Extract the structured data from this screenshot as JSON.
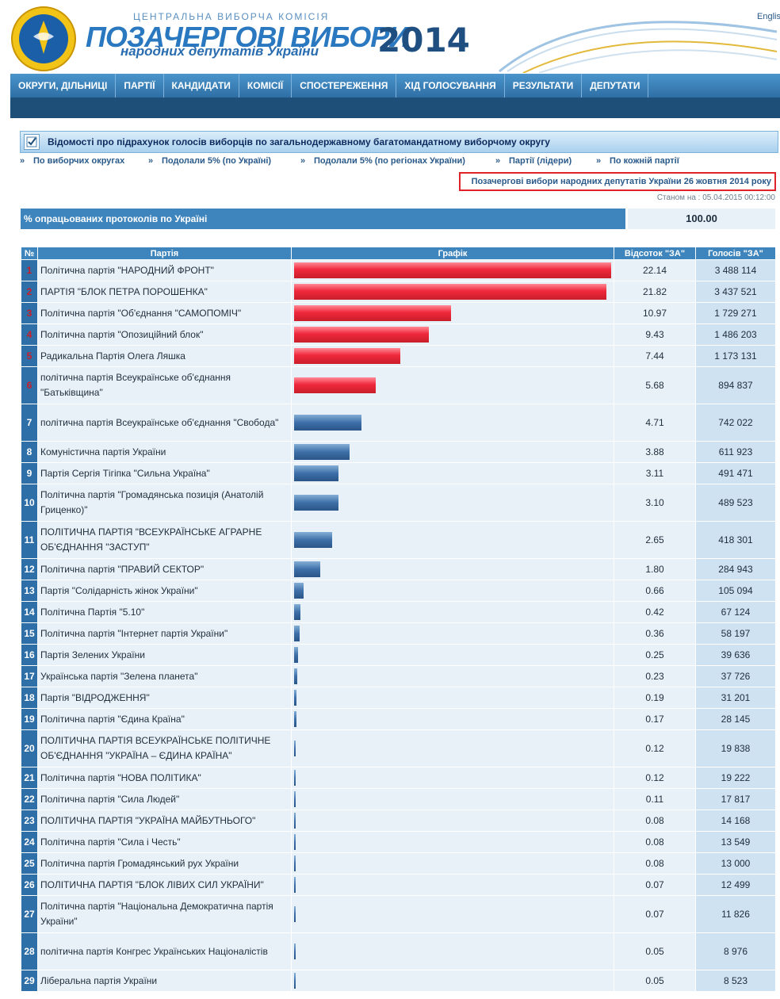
{
  "header": {
    "org": "ЦЕНТРАЛЬНА ВИБОРЧА КОМІСІЯ",
    "title": "ПОЗАЧЕРГОВІ ВИБОРИ",
    "subtitle": "народних депутатів України",
    "year": "2014",
    "lang": "English",
    "emblem_text": "ЦЕНТРАЛЬНА ВИБОРЧА КОМІСІЯ"
  },
  "nav": {
    "items": [
      "ОКРУГИ, ДІЛЬНИЦІ",
      "ПАРТІЇ",
      "КАНДИДАТИ",
      "КОМІСІЇ",
      "СПОСТЕРЕЖЕННЯ",
      "ХІД ГОЛОСУВАННЯ",
      "РЕЗУЛЬТАТИ",
      "ДЕПУТАТИ"
    ]
  },
  "section": {
    "title": "Відомості про підрахунок голосів виборців по загальнодержавному багатомандатному виборчому округу"
  },
  "subnav": {
    "items": [
      "По виборчих округах",
      "Подолали 5% (по Україні)",
      "Подолали 5% (по регіонах України)",
      "Партії (лідери)",
      "По кожній партії"
    ],
    "prefix": "»"
  },
  "election_link": "Позачергові вибори народних депутатів України 26 жовтня 2014 року",
  "status": "Станом на : 05.04.2015 00:12:00",
  "protocols": {
    "label": "% опрацьованих протоколів по Україні",
    "value": "100.00"
  },
  "table": {
    "headers": [
      "№",
      "Партія",
      "Графік",
      "Відсоток \"ЗА\"",
      "Голосів \"ЗА\""
    ],
    "rows": [
      {
        "n": "1",
        "party": "Політична партія \"НАРОДНИЙ ФРОНТ\"",
        "pct": "22.14",
        "votes": "3 488 114",
        "color": "red"
      },
      {
        "n": "2",
        "party": "ПАРТІЯ \"БЛОК ПЕТРА ПОРОШЕНКА\"",
        "pct": "21.82",
        "votes": "3 437 521",
        "color": "red"
      },
      {
        "n": "3",
        "party": "Політична партія \"Об'єднання \"САМОПОМІЧ\"",
        "pct": "10.97",
        "votes": "1 729 271",
        "color": "red"
      },
      {
        "n": "4",
        "party": "Політична партія \"Опозиційний блок\"",
        "pct": "9.43",
        "votes": "1 486 203",
        "color": "red"
      },
      {
        "n": "5",
        "party": "Радикальна Партія Олега Ляшка",
        "pct": "7.44",
        "votes": "1 173 131",
        "color": "red"
      },
      {
        "n": "6",
        "party": "політична партія Всеукраїнське об'єднання \"Батьківщина\"",
        "pct": "5.68",
        "votes": "894 837",
        "color": "red"
      },
      {
        "n": "7",
        "party": "політична партія Всеукраїнське об'єднання \"Свобода\"",
        "pct": "4.71",
        "votes": "742 022",
        "color": "blue"
      },
      {
        "n": "8",
        "party": "Комуністична партія України",
        "pct": "3.88",
        "votes": "611 923",
        "color": "blue"
      },
      {
        "n": "9",
        "party": "Партія Сергія Тігіпка \"Сильна Україна\"",
        "pct": "3.11",
        "votes": "491 471",
        "color": "blue"
      },
      {
        "n": "10",
        "party": "Політична партія \"Громадянська позиція (Анатолій Гриценко)\"",
        "pct": "3.10",
        "votes": "489 523",
        "color": "blue"
      },
      {
        "n": "11",
        "party": "ПОЛІТИЧНА ПАРТІЯ \"ВСЕУКРАЇНСЬКЕ АГРАРНЕ ОБ'ЄДНАННЯ \"ЗАСТУП\"",
        "pct": "2.65",
        "votes": "418 301",
        "color": "blue"
      },
      {
        "n": "12",
        "party": "Політична партія \"ПРАВИЙ СЕКТОР\"",
        "pct": "1.80",
        "votes": "284 943",
        "color": "blue"
      },
      {
        "n": "13",
        "party": "Партія \"Солідарність жінок України\"",
        "pct": "0.66",
        "votes": "105 094",
        "color": "blue"
      },
      {
        "n": "14",
        "party": "Політична Партія \"5.10\"",
        "pct": "0.42",
        "votes": "67 124",
        "color": "blue"
      },
      {
        "n": "15",
        "party": "Політична партія \"Інтернет партія України\"",
        "pct": "0.36",
        "votes": "58 197",
        "color": "blue"
      },
      {
        "n": "16",
        "party": "Партія Зелених України",
        "pct": "0.25",
        "votes": "39 636",
        "color": "blue"
      },
      {
        "n": "17",
        "party": "Українська партія \"Зелена планета\"",
        "pct": "0.23",
        "votes": "37 726",
        "color": "blue"
      },
      {
        "n": "18",
        "party": "Партія \"ВІДРОДЖЕННЯ\"",
        "pct": "0.19",
        "votes": "31 201",
        "color": "blue"
      },
      {
        "n": "19",
        "party": "Політична партія \"Єдина Країна\"",
        "pct": "0.17",
        "votes": "28 145",
        "color": "blue"
      },
      {
        "n": "20",
        "party": "ПОЛІТИЧНА ПАРТІЯ ВСЕУКРАЇНСЬКЕ ПОЛІТИЧНЕ ОБ'ЄДНАННЯ \"УКРАЇНА – ЄДИНА КРАЇНА\"",
        "pct": "0.12",
        "votes": "19 838",
        "color": "blue"
      },
      {
        "n": "21",
        "party": "Політична партія \"НОВА ПОЛІТИКА\"",
        "pct": "0.12",
        "votes": "19 222",
        "color": "blue"
      },
      {
        "n": "22",
        "party": "Політична партія \"Сила Людей\"",
        "pct": "0.11",
        "votes": "17 817",
        "color": "blue"
      },
      {
        "n": "23",
        "party": "ПОЛІТИЧНА ПАРТІЯ \"УКРАЇНА МАЙБУТНЬОГО\"",
        "pct": "0.08",
        "votes": "14 168",
        "color": "blue"
      },
      {
        "n": "24",
        "party": "Політична партія \"Сила і Честь\"",
        "pct": "0.08",
        "votes": "13 549",
        "color": "blue"
      },
      {
        "n": "25",
        "party": "Політична партія Громадянський рух України",
        "pct": "0.08",
        "votes": "13 000",
        "color": "blue"
      },
      {
        "n": "26",
        "party": "ПОЛІТИЧНА ПАРТІЯ \"БЛОК ЛІВИХ СИЛ УКРАЇНИ\"",
        "pct": "0.07",
        "votes": "12 499",
        "color": "blue"
      },
      {
        "n": "27",
        "party": "Політична партія \"Національна Демократична партія України\"",
        "pct": "0.07",
        "votes": "11 826",
        "color": "blue"
      },
      {
        "n": "28",
        "party": "політична партія Конгрес Українських Націоналістів",
        "pct": "0.05",
        "votes": "8 976",
        "color": "blue"
      },
      {
        "n": "29",
        "party": "Ліберальна партія України",
        "pct": "0.05",
        "votes": "8 523",
        "color": "blue"
      }
    ]
  },
  "colors": {
    "nav_bg": "#3a84bf",
    "header_dark": "#1e4f79",
    "bar_red": "#e8283c",
    "bar_blue": "#3d6fa8",
    "highlight_border": "#e0222a",
    "link": "#2a5a8a"
  }
}
